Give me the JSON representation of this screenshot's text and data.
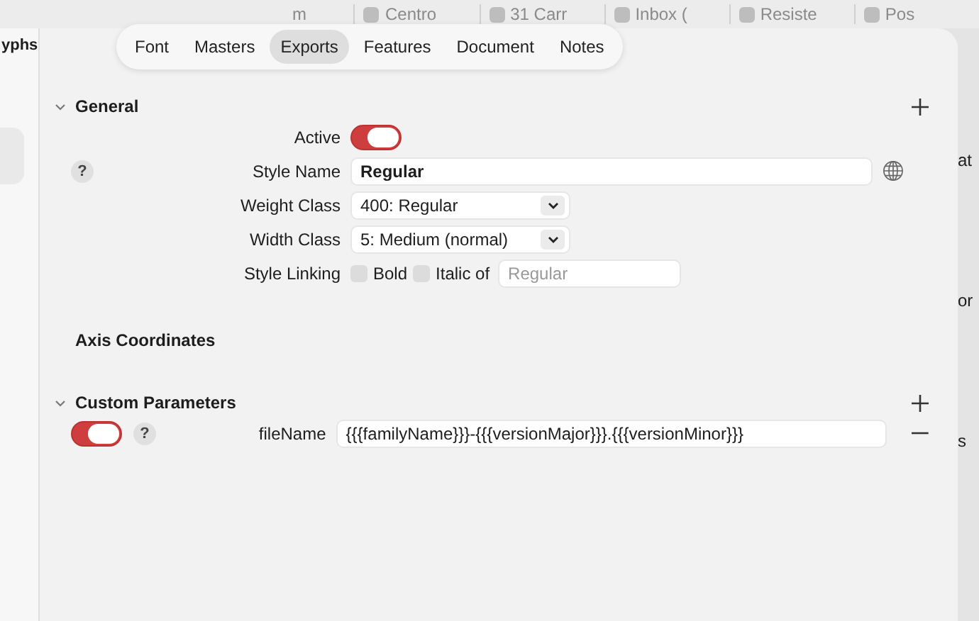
{
  "browser_tabs": [
    {
      "label": "m"
    },
    {
      "label": "Centro"
    },
    {
      "label": "31 Carr"
    },
    {
      "label": "Inbox ("
    },
    {
      "label": "Resiste"
    },
    {
      "label": "Pos"
    }
  ],
  "sidebar": {
    "title": "yphs"
  },
  "tabs": [
    {
      "label": "Font",
      "selected": false
    },
    {
      "label": "Masters",
      "selected": false
    },
    {
      "label": "Exports",
      "selected": true
    },
    {
      "label": "Features",
      "selected": false
    },
    {
      "label": "Document",
      "selected": false
    },
    {
      "label": "Notes",
      "selected": false
    }
  ],
  "general": {
    "title": "General",
    "expanded": true,
    "active": {
      "label": "Active",
      "on": true
    },
    "style_name": {
      "label": "Style Name",
      "value": "Regular",
      "help": "?"
    },
    "weight_class": {
      "label": "Weight Class",
      "value": "400: Regular"
    },
    "width_class": {
      "label": "Width Class",
      "value": "5: Medium (normal)"
    },
    "style_linking": {
      "label": "Style Linking",
      "bold": {
        "label": "Bold",
        "checked": false
      },
      "italic_of": {
        "label": "Italic of",
        "checked": false,
        "placeholder": "Regular"
      }
    }
  },
  "axis_coordinates": {
    "title": "Axis Coordinates"
  },
  "custom_parameters": {
    "title": "Custom Parameters",
    "expanded": true,
    "rows": [
      {
        "on": true,
        "help": "?",
        "name": "fileName",
        "value": "{{{familyName}}}-{{{versionMajor}}}.{{{versionMinor}}}"
      }
    ]
  },
  "right_edge": [
    "at",
    "or",
    "s"
  ]
}
